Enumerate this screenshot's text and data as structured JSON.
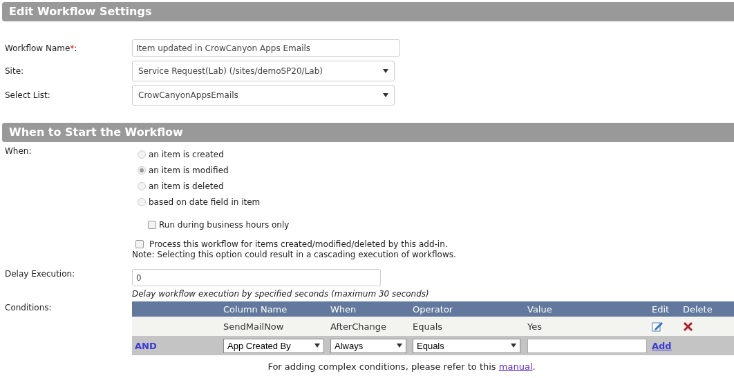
{
  "sections": [
    {
      "title": "Edit Workflow Settings"
    },
    {
      "title": "When to Start the Workflow"
    }
  ],
  "workflow_name": {
    "label": "Workflow Name",
    "required_mark": "*",
    "label_end": ":",
    "value": "Item updated in CrowCanyon Apps Emails"
  },
  "site": {
    "label": "Site:",
    "value": "Service Request(Lab) (/sites/demoSP20/Lab)"
  },
  "select_list": {
    "label": "Select List:",
    "value": "CrowCanyonAppsEmails"
  },
  "when": {
    "label": "When:",
    "options": [
      {
        "label": "an item is created",
        "selected": false
      },
      {
        "label": "an item is modified",
        "selected": true
      },
      {
        "label": "an item is deleted",
        "selected": false
      },
      {
        "label": "based on date field in item",
        "selected": false
      }
    ],
    "business_hours": {
      "label": "Run during business hours only",
      "checked": false
    },
    "process_addin": {
      "label": "Process this workflow for items created/modified/deleted by this add-in.",
      "checked": false
    },
    "note": "Note: Selecting this option could result in a cascading execution of workflows."
  },
  "delay": {
    "label": "Delay Execution:",
    "value": "0",
    "hint": "Delay workflow execution by specified seconds (maximum 30 seconds)"
  },
  "conditions": {
    "label": "Conditions:",
    "columns": [
      "Column Name",
      "When",
      "Operator",
      "Value",
      "Edit",
      "Delete"
    ],
    "rows": [
      {
        "column_name": "SendMailNow",
        "when": "AfterChange",
        "operator": "Equals",
        "value": "Yes"
      }
    ],
    "new_row": {
      "conjunction": "AND",
      "column_name": "App Created By",
      "when": "Always",
      "operator": "Equals",
      "add": "Add"
    }
  },
  "footer": {
    "text": "For adding complex conditions, please refer to this ",
    "link": "manual",
    "end": "."
  }
}
